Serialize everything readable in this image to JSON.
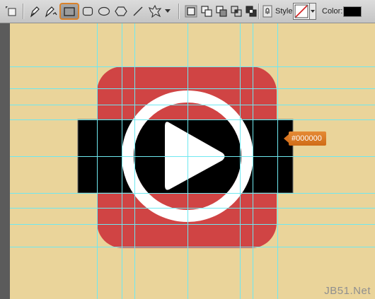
{
  "toolbar": {
    "tools": [
      {
        "name": "rect-marquee-icon"
      },
      {
        "name": "pen-icon"
      },
      {
        "name": "freeform-pen-icon"
      },
      {
        "name": "rectangle-tool-icon",
        "active": true
      },
      {
        "name": "rounded-rectangle-tool-icon"
      },
      {
        "name": "ellipse-tool-icon"
      },
      {
        "name": "polygon-tool-icon"
      },
      {
        "name": "line-tool-icon"
      },
      {
        "name": "custom-shape-tool-icon"
      }
    ],
    "path_modes": [
      "new-layer-icon",
      "add-to-shape-icon",
      "subtract-from-shape-icon",
      "intersect-shape-icon",
      "exclude-overlap-icon"
    ],
    "style_label": "Style:",
    "color_label": "Color:",
    "color_value": "#000000"
  },
  "canvas": {
    "background_color": "#ead49a",
    "guide_color": "#6fe8f0",
    "icon_base_color": "#d04444",
    "band_color": "#000000",
    "ring_color": "#ffffff",
    "play_color": "#ffffff"
  },
  "color_tooltip": {
    "text": "#000000",
    "color": "#d9731e"
  },
  "watermark": "JB51.Net"
}
